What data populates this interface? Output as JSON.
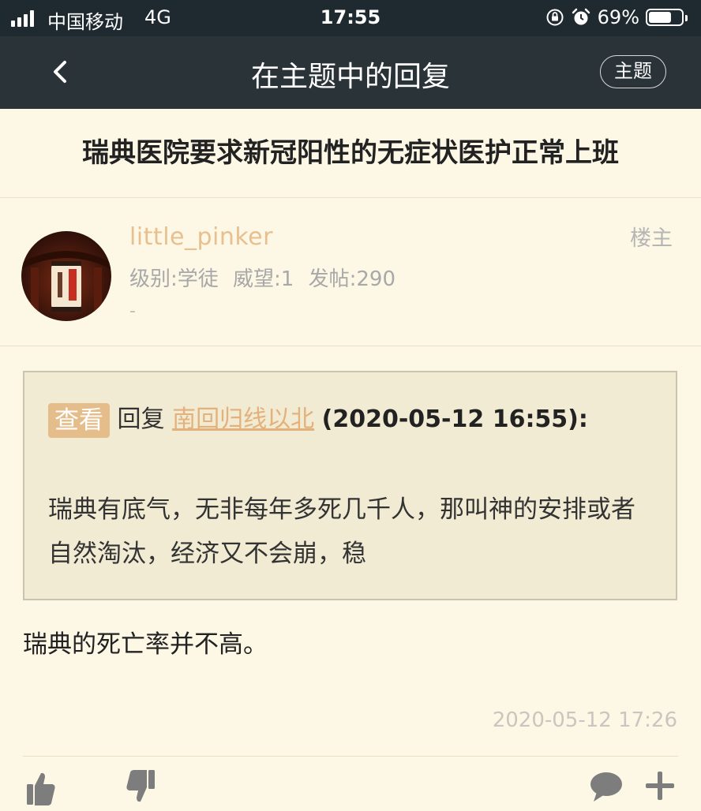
{
  "status_bar": {
    "carrier": "中国移动",
    "network": "4G",
    "time": "17:55",
    "battery": "69%",
    "battery_level": 0.69
  },
  "nav": {
    "title": "在主题中的回复",
    "topic_button": "主题"
  },
  "thread": {
    "title": "瑞典医院要求新冠阳性的无症状医护正常上班"
  },
  "author": {
    "name": "little_pinker",
    "level": "级别:学徒",
    "prestige": "威望:1",
    "posts": "发帖:290",
    "signature": "-",
    "floor_tag": "楼主"
  },
  "quote": {
    "view_label": "查看",
    "reply_word": "回复",
    "quoted_user": "南回归线以北",
    "quoted_time": "(2020-05-12 16:55):",
    "text": "瑞典有底气，无非每年多死几千人，那叫神的安排或者自然淘汰，经济又不会崩，稳"
  },
  "reply": {
    "text": "瑞典的死亡率并不高。",
    "timestamp": "2020-05-12 17:26"
  },
  "colors": {
    "nav_bg": "#2a3338",
    "page_bg": "#fdf7e5",
    "accent": "#e4bd8a",
    "icon": "#7d7d7d"
  },
  "icons": [
    "back-arrow-icon",
    "thumbs-up-icon",
    "thumbs-down-icon",
    "comment-icon",
    "plus-icon"
  ]
}
